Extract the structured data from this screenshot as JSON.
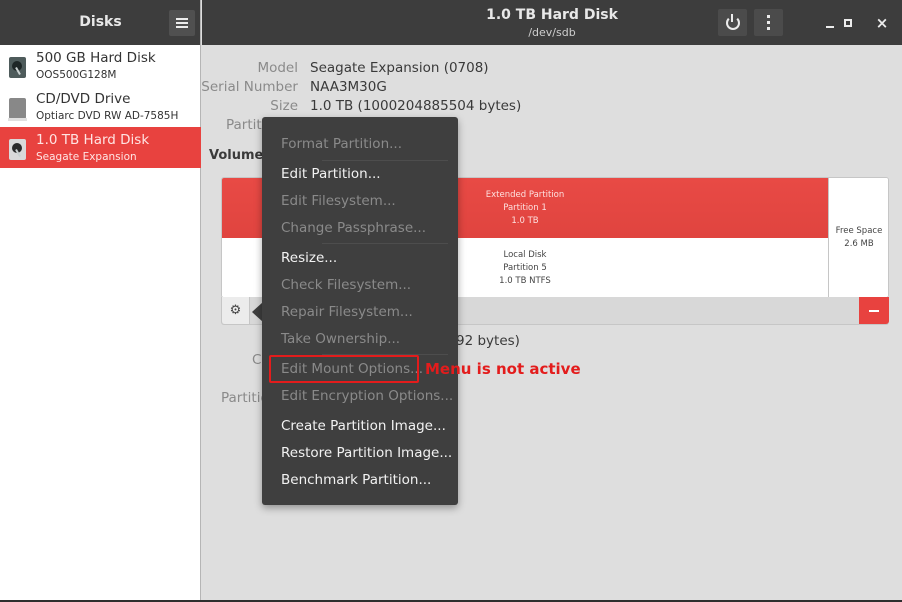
{
  "sidebar": {
    "title": "Disks",
    "menu_icon": "hamburger-icon",
    "disks": [
      {
        "name": "500 GB Hard Disk",
        "subtitle": "OOS500G128M",
        "icon": "hard-disk-icon",
        "selected": false
      },
      {
        "name": "CD/DVD Drive",
        "subtitle": "Optiarc DVD RW AD-7585H",
        "icon": "optical-drive-icon",
        "selected": false
      },
      {
        "name": "1.0 TB Hard Disk",
        "subtitle": "Seagate Expansion",
        "icon": "hard-disk-icon",
        "selected": true
      }
    ]
  },
  "header": {
    "title": "1.0 TB Hard Disk",
    "subtitle": "/dev/sdb",
    "power_icon": "power-icon",
    "more_icon": "kebab-menu-icon",
    "window_controls": [
      "minimize",
      "maximize",
      "close"
    ],
    "close_glyph": "×"
  },
  "info": {
    "model_label": "Model",
    "model_value": "Seagate Expansion (0708)",
    "serial_label": "Serial Number",
    "serial_value": "NAA3M30G",
    "size_label": "Size",
    "size_value": "1.0 TB (1000204885504 bytes)",
    "partitioning_label": "Partiti"
  },
  "volumes": {
    "label": "Volumes",
    "extended": {
      "line1": "Extended Partition",
      "line2": "Partition 1",
      "line3": "1.0 TB"
    },
    "local": {
      "line1": "Local Disk",
      "line2": "Partition 5",
      "line3": "1.0 TB NTFS"
    },
    "free": {
      "line1": "Free Space",
      "line2": "2.6 MB"
    },
    "gear_glyph": "⚙",
    "partial_size_text": "92 bytes)",
    "partial_label_1": "Co",
    "partial_label_2": "Partitio"
  },
  "context_menu": {
    "items": [
      {
        "label": "Format Partition...",
        "enabled": false
      },
      {
        "label": "Edit Partition...",
        "enabled": true
      },
      {
        "label": "Edit Filesystem...",
        "enabled": false
      },
      {
        "label": "Change Passphrase...",
        "enabled": false
      },
      {
        "label": "Resize...",
        "enabled": true
      },
      {
        "label": "Check Filesystem...",
        "enabled": false
      },
      {
        "label": "Repair Filesystem...",
        "enabled": false
      },
      {
        "label": "Take Ownership...",
        "enabled": false
      },
      {
        "label": "Edit Mount Options...",
        "enabled": false
      },
      {
        "label": "Edit Encryption Options...",
        "enabled": false
      },
      {
        "label": "Create Partition Image...",
        "enabled": true
      },
      {
        "label": "Restore Partition Image...",
        "enabled": true
      },
      {
        "label": "Benchmark Partition...",
        "enabled": true
      }
    ]
  },
  "annotation": {
    "text": "Menu is not active",
    "color": "#e31c1c"
  },
  "colors": {
    "accent": "#e8423f",
    "header_bg": "#3d3d3d",
    "menu_bg": "#3f3f3f",
    "content_bg": "#dedede"
  }
}
